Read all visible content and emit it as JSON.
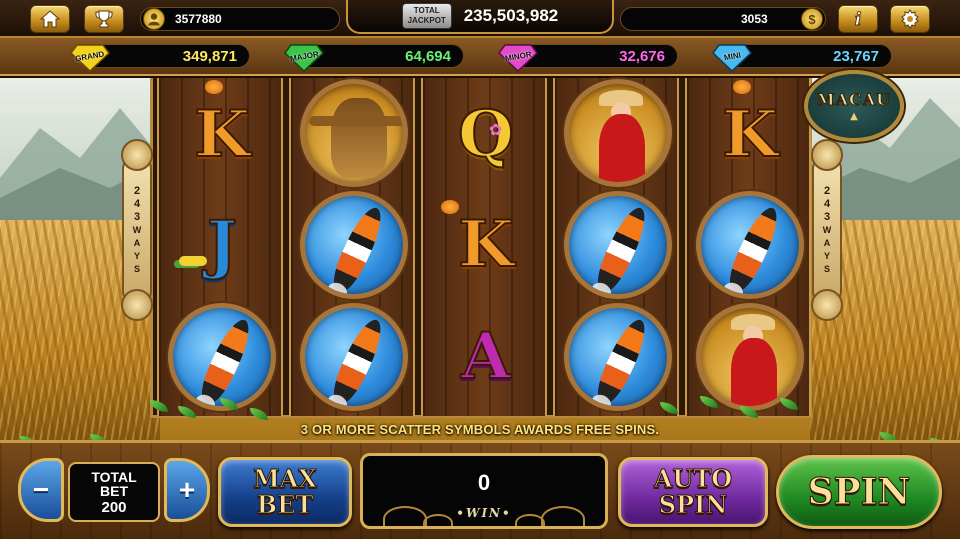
{
  "top_bar": {
    "home_icon": "home-icon",
    "trophy_icon": "trophy-icon",
    "user_id": "3577880",
    "jackpot_badge_line1": "TOTAL",
    "jackpot_badge_line2": "JACKPOT",
    "total_jackpot": "235,503,982",
    "coins": "3053",
    "coin_symbol": "$",
    "info_label": "i",
    "settings_icon": "gear-icon"
  },
  "jackpots": [
    {
      "label": "GRAND",
      "value": "349,871",
      "color": "#ffe860",
      "gem": "#f2d21a"
    },
    {
      "label": "MAJOR",
      "value": "64,694",
      "color": "#6cf07a",
      "gem": "#3ac44a"
    },
    {
      "label": "MINOR",
      "value": "32,676",
      "color": "#ff66e8",
      "gem": "#e04cc8"
    },
    {
      "label": "MINI",
      "value": "23,767",
      "color": "#6ad4ff",
      "gem": "#4ab8f0"
    }
  ],
  "ways": {
    "left": [
      "2",
      "4",
      "3",
      "W",
      "A",
      "Y",
      "S"
    ],
    "right": [
      "2",
      "4",
      "3",
      "W",
      "A",
      "Y",
      "S"
    ]
  },
  "macau_label": "MACAU",
  "reels": [
    [
      "K",
      "J",
      "koi"
    ],
    [
      "scarecrow",
      "koi",
      "koi"
    ],
    [
      "Q",
      "K",
      "A"
    ],
    [
      "lady",
      "koi",
      "koi"
    ],
    [
      "K",
      "koi",
      "lady"
    ]
  ],
  "scatter_message": "3 OR MORE SCATTER SYMBOLS AWARDS FREE SPINS.",
  "bottom": {
    "decrease": "−",
    "increase": "+",
    "bet_label_1": "TOTAL",
    "bet_label_2": "BET",
    "bet_value": "200",
    "max_1": "MAX",
    "max_2": "BET",
    "win_amount": "0",
    "win_label": "•WIN•",
    "auto_1": "AUTO",
    "auto_2": "SPIN",
    "spin": "SPIN"
  }
}
